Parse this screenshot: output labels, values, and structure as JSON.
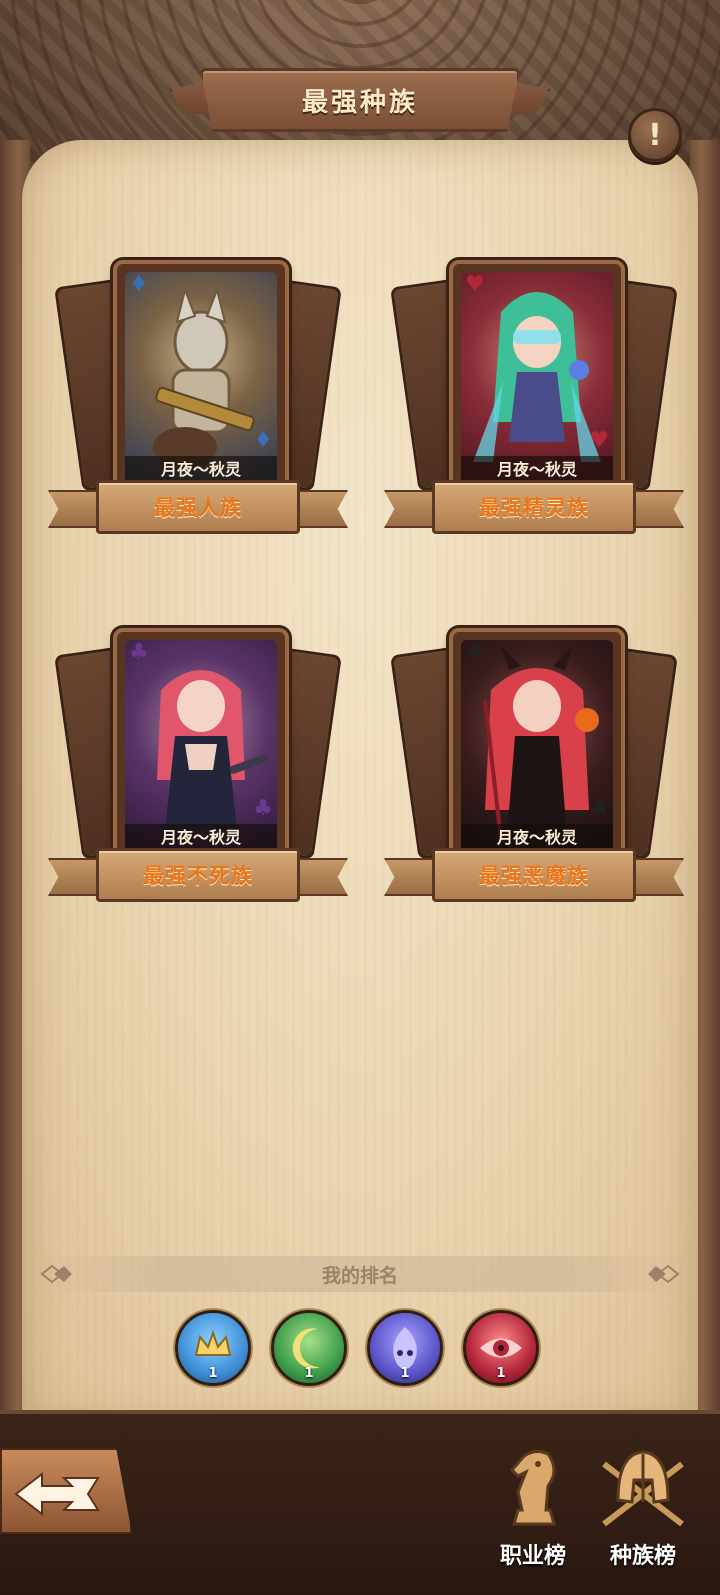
{
  "header": {
    "title": "最强种族"
  },
  "info_button": {
    "icon": "exclamation-icon",
    "glyph": "!"
  },
  "cards": [
    {
      "id": "human",
      "caption": "月夜～秋灵",
      "title": "最强人族",
      "suit": "♦",
      "suit_color": "#3b6fb0",
      "theme": "#2b3a55"
    },
    {
      "id": "elf",
      "caption": "月夜～秋灵",
      "title": "最强精灵族",
      "suit": "♥",
      "suit_color": "#b0283a",
      "theme": "#6e1f2a"
    },
    {
      "id": "undead",
      "caption": "月夜～秋灵",
      "title": "最强不死族",
      "suit": "♣",
      "suit_color": "#6a3a8e",
      "theme": "#3e2450"
    },
    {
      "id": "demon",
      "caption": "月夜～秋灵",
      "title": "最强恶魔族",
      "suit": "♠",
      "suit_color": "#222222",
      "theme": "#1f1a1a"
    }
  ],
  "my_ranking": {
    "label": "我的排名",
    "races": [
      {
        "name": "human-race-icon",
        "color": "#3f8fd6",
        "rank": "1"
      },
      {
        "name": "elf-race-icon",
        "color": "#3f9d4a",
        "rank": "1"
      },
      {
        "name": "undead-race-icon",
        "color": "#5b55c8",
        "rank": "1"
      },
      {
        "name": "demon-race-icon",
        "color": "#b3263a",
        "rank": "1"
      }
    ]
  },
  "bottom_nav": {
    "back_icon": "back-arrow-icon",
    "items": [
      {
        "label": "职业榜",
        "icon": "chess-knight-icon"
      },
      {
        "label": "种族榜",
        "icon": "helmet-crossed-swords-icon"
      }
    ]
  }
}
